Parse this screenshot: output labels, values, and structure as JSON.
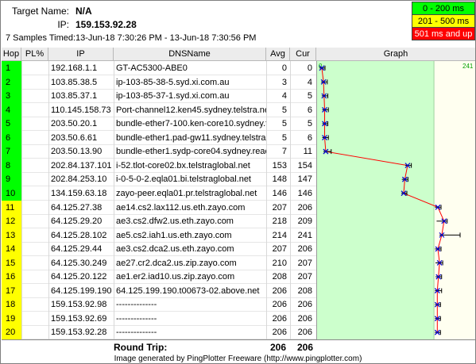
{
  "header": {
    "target_label": "Target Name:",
    "target_value": "N/A",
    "ip_label": "IP:",
    "ip_value": "159.153.92.28",
    "samples_label": "7 Samples Timed:",
    "samples_value": "13-Jun-18 7:30:26 PM - 13-Jun-18 7:30:56 PM"
  },
  "legend": [
    {
      "label": "0 - 200 ms",
      "color": "#00ff00",
      "text_color": "#000000"
    },
    {
      "label": "201 - 500 ms",
      "color": "#ffff00",
      "text_color": "#000000"
    },
    {
      "label": "501 ms and up",
      "color": "#ff0000",
      "text_color": "#ffffff"
    }
  ],
  "columns": {
    "hop": "Hop",
    "pl": "PL%",
    "ip": "IP",
    "dns": "DNSName",
    "avg": "Avg",
    "cur": "Cur",
    "graph": "Graph"
  },
  "graph": {
    "scale_min": "0",
    "scale_max": "241",
    "green_color": "#ccffcc",
    "yellow_color": "#fffff0",
    "line_color": "#ff0000",
    "marker_color": "#0000cc"
  },
  "hops": [
    {
      "hop": "1",
      "pl": "",
      "ip": "192.168.1.1",
      "dns": "GT-AC5300-ABE0",
      "avg": "0",
      "cur": "0",
      "color": "#00ff00"
    },
    {
      "hop": "2",
      "pl": "",
      "ip": "103.85.38.5",
      "dns": "ip-103-85-38-5.syd.xi.com.au",
      "avg": "3",
      "cur": "4",
      "color": "#00ff00"
    },
    {
      "hop": "3",
      "pl": "",
      "ip": "103.85.37.1",
      "dns": "ip-103-85-37-1.syd.xi.com.au",
      "avg": "4",
      "cur": "5",
      "color": "#00ff00"
    },
    {
      "hop": "4",
      "pl": "",
      "ip": "110.145.158.73",
      "dns": "Port-channel12.ken45.sydney.telstra.ne",
      "avg": "5",
      "cur": "6",
      "color": "#00ff00"
    },
    {
      "hop": "5",
      "pl": "",
      "ip": "203.50.20.1",
      "dns": "bundle-ether7-100.ken-core10.sydney.t",
      "avg": "5",
      "cur": "5",
      "color": "#00ff00"
    },
    {
      "hop": "6",
      "pl": "",
      "ip": "203.50.6.61",
      "dns": "bundle-ether1.pad-gw11.sydney.telstra",
      "avg": "5",
      "cur": "6",
      "color": "#00ff00"
    },
    {
      "hop": "7",
      "pl": "",
      "ip": "203.50.13.90",
      "dns": "bundle-ether1.sydp-core04.sydney.reac",
      "avg": "7",
      "cur": "11",
      "color": "#00ff00"
    },
    {
      "hop": "8",
      "pl": "",
      "ip": "202.84.137.101",
      "dns": "i-52.tlot-core02.bx.telstraglobal.net",
      "avg": "153",
      "cur": "154",
      "color": "#00ff00"
    },
    {
      "hop": "9",
      "pl": "",
      "ip": "202.84.253.10",
      "dns": "i-0-5-0-2.eqla01.bi.telstraglobal.net",
      "avg": "148",
      "cur": "147",
      "color": "#00ff00"
    },
    {
      "hop": "10",
      "pl": "",
      "ip": "134.159.63.18",
      "dns": "zayo-peer.eqla01.pr.telstraglobal.net",
      "avg": "146",
      "cur": "146",
      "color": "#00ff00"
    },
    {
      "hop": "11",
      "pl": "",
      "ip": "64.125.27.38",
      "dns": "ae14.cs2.lax112.us.eth.zayo.com",
      "avg": "207",
      "cur": "206",
      "color": "#ffff00"
    },
    {
      "hop": "12",
      "pl": "",
      "ip": "64.125.29.20",
      "dns": "ae3.cs2.dfw2.us.eth.zayo.com",
      "avg": "218",
      "cur": "209",
      "color": "#ffff00"
    },
    {
      "hop": "13",
      "pl": "",
      "ip": "64.125.28.102",
      "dns": "ae5.cs2.iah1.us.eth.zayo.com",
      "avg": "214",
      "cur": "241",
      "color": "#ffff00"
    },
    {
      "hop": "14",
      "pl": "",
      "ip": "64.125.29.44",
      "dns": "ae3.cs2.dca2.us.eth.zayo.com",
      "avg": "207",
      "cur": "206",
      "color": "#ffff00"
    },
    {
      "hop": "15",
      "pl": "",
      "ip": "64.125.30.249",
      "dns": "ae27.cr2.dca2.us.zip.zayo.com",
      "avg": "210",
      "cur": "207",
      "color": "#ffff00"
    },
    {
      "hop": "16",
      "pl": "",
      "ip": "64.125.20.122",
      "dns": "ae1.er2.iad10.us.zip.zayo.com",
      "avg": "208",
      "cur": "207",
      "color": "#ffff00"
    },
    {
      "hop": "17",
      "pl": "",
      "ip": "64.125.199.190",
      "dns": "64.125.199.190.t00673-02.above.net",
      "avg": "206",
      "cur": "208",
      "color": "#ffff00"
    },
    {
      "hop": "18",
      "pl": "",
      "ip": "159.153.92.98",
      "dns": "--------------",
      "avg": "206",
      "cur": "206",
      "color": "#ffff00"
    },
    {
      "hop": "19",
      "pl": "",
      "ip": "159.153.92.69",
      "dns": "--------------",
      "avg": "206",
      "cur": "206",
      "color": "#ffff00"
    },
    {
      "hop": "20",
      "pl": "",
      "ip": "159.153.92.28",
      "dns": "--------------",
      "avg": "206",
      "cur": "206",
      "color": "#ffff00"
    }
  ],
  "roundtrip": {
    "label": "Round Trip:",
    "avg": "206",
    "cur": "206"
  },
  "footer": "Image generated by PingPlotter Freeware (http://www.pingplotter.com)"
}
